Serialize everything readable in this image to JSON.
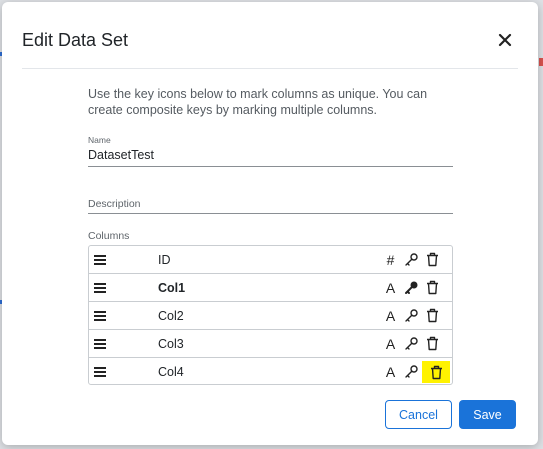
{
  "dialog": {
    "title": "Edit Data Set",
    "intro": "Use the key icons below to mark columns as unique. You can create composite keys by marking multiple columns."
  },
  "fields": {
    "name_label": "Name",
    "name_value": "DatasetTest",
    "description_label": "Description",
    "description_value": ""
  },
  "columns_label": "Columns",
  "columns": [
    {
      "name": "ID",
      "type_symbol": "#",
      "is_key": false,
      "bold": false
    },
    {
      "name": "Col1",
      "type_symbol": "A",
      "is_key": true,
      "bold": true
    },
    {
      "name": "Col2",
      "type_symbol": "A",
      "is_key": false,
      "bold": false
    },
    {
      "name": "Col3",
      "type_symbol": "A",
      "is_key": false,
      "bold": false
    },
    {
      "name": "Col4",
      "type_symbol": "A",
      "is_key": false,
      "bold": false
    }
  ],
  "buttons": {
    "cancel": "Cancel",
    "save": "Save"
  },
  "colors": {
    "accent": "#1a73d9",
    "highlight": "#fff200"
  }
}
